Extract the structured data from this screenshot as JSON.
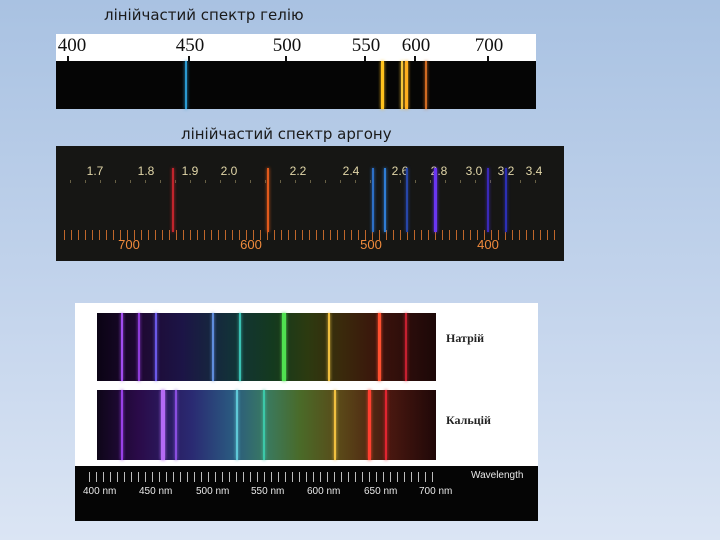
{
  "helium": {
    "title": "лінійчастий спектр гелію",
    "scale_labels": [
      "400",
      "450",
      "500",
      "550",
      "600",
      "700"
    ],
    "lines": [
      {
        "color": "#2b9ad1",
        "pos": 0.269,
        "w": 2
      },
      {
        "color": "#ffc21d",
        "pos": 0.677,
        "w": 3
      },
      {
        "color": "#f5c73c",
        "pos": 0.719,
        "w": 2
      },
      {
        "color": "#ffae1e",
        "pos": 0.727,
        "w": 3
      },
      {
        "color": "#d06a22",
        "pos": 0.769,
        "w": 2
      }
    ]
  },
  "argon": {
    "title": "лінійчастий спектр аргону",
    "top_labels": [
      "1.7",
      "1.8",
      "1.9",
      "2.0",
      "2.2",
      "2.4",
      "2.6",
      "2.8",
      "3.0",
      "3.2",
      "3.4"
    ],
    "bottom_labels": [
      "700",
      "600",
      "500",
      "400"
    ],
    "lines": [
      {
        "color": "#c0242c",
        "pos": 0.229,
        "w": 2
      },
      {
        "color": "#e15a1c",
        "pos": 0.415,
        "w": 2
      },
      {
        "color": "#2d6fc6",
        "pos": 0.622,
        "w": 2
      },
      {
        "color": "#2f7dd5",
        "pos": 0.645,
        "w": 2
      },
      {
        "color": "#2746a8",
        "pos": 0.689,
        "w": 2
      },
      {
        "color": "#6a36f2",
        "pos": 0.744,
        "w": 3
      },
      {
        "color": "#3a29b8",
        "pos": 0.848,
        "w": 2
      },
      {
        "color": "#2c2fb6",
        "pos": 0.884,
        "w": 2
      }
    ]
  },
  "figure": {
    "sodium_name": "Натрій",
    "calcium_name": "Кальцій",
    "wavelength_title": "Wavelength",
    "wavelength_labels": [
      "400 nm",
      "450 nm",
      "500 nm",
      "550 nm",
      "600 nm",
      "650 nm",
      "700 nm"
    ],
    "sodium_lines": [
      {
        "color": "#a24cf0",
        "pos": 0.07,
        "w": 2
      },
      {
        "color": "#8e3cd8",
        "pos": 0.12,
        "w": 2
      },
      {
        "color": "#6b59e8",
        "pos": 0.17,
        "w": 2
      },
      {
        "color": "#5f8cdc",
        "pos": 0.34,
        "w": 2
      },
      {
        "color": "#3ac2b4",
        "pos": 0.42,
        "w": 2
      },
      {
        "color": "#50e050",
        "pos": 0.545,
        "w": 4
      },
      {
        "color": "#f0c040",
        "pos": 0.68,
        "w": 2
      },
      {
        "color": "#ff5030",
        "pos": 0.83,
        "w": 3
      },
      {
        "color": "#c52030",
        "pos": 0.91,
        "w": 2
      }
    ],
    "calcium_lines": [
      {
        "color": "#9940e8",
        "pos": 0.07,
        "w": 2
      },
      {
        "color": "#b56af5",
        "pos": 0.19,
        "w": 4
      },
      {
        "color": "#8a4ee0",
        "pos": 0.23,
        "w": 2
      },
      {
        "color": "#5fc8d8",
        "pos": 0.41,
        "w": 2
      },
      {
        "color": "#3cc8a8",
        "pos": 0.49,
        "w": 2
      },
      {
        "color": "#f0c040",
        "pos": 0.7,
        "w": 2
      },
      {
        "color": "#ff4030",
        "pos": 0.8,
        "w": 3
      },
      {
        "color": "#e02530",
        "pos": 0.85,
        "w": 2
      }
    ]
  }
}
